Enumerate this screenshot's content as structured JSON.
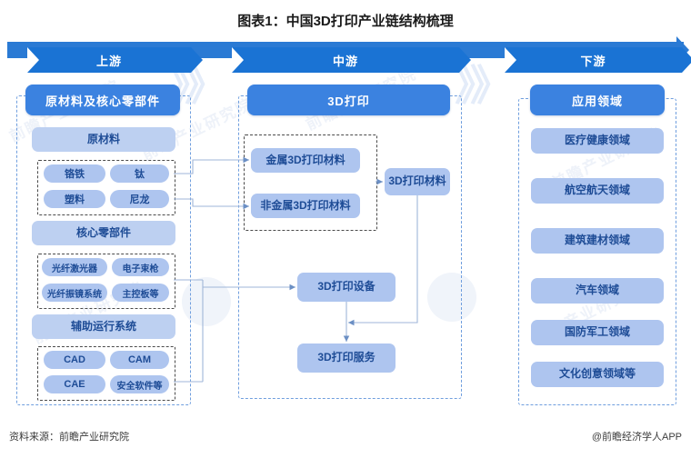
{
  "title": "图表1：中国3D打印产业链结构梳理",
  "banner": {
    "stages": [
      {
        "label": "上游"
      },
      {
        "label": "中游"
      },
      {
        "label": "下游"
      }
    ]
  },
  "upstream": {
    "header": "原材料及核心零部件",
    "groups": [
      {
        "label": "原材料",
        "items": [
          "铬铁",
          "钛",
          "塑料",
          "尼龙"
        ]
      },
      {
        "label": "核心零部件",
        "items": [
          "光纤激光器",
          "电子束枪",
          "光纤振镜系统",
          "主控板等"
        ]
      },
      {
        "label": "辅助运行系统",
        "items": [
          "CAD",
          "CAM",
          "CAE",
          "安全软件等"
        ]
      }
    ]
  },
  "midstream": {
    "header": "3D打印",
    "materials": [
      "金属3D打印材料",
      "非金属3D打印材料"
    ],
    "material_node": "3D打印材料",
    "equipment_node": "3D打印设备",
    "service_node": "3D打印服务"
  },
  "downstream": {
    "header": "应用领域",
    "items": [
      "医疗健康领域",
      "航空航天领域",
      "建筑建材领域",
      "汽车领域",
      "国防军工领域",
      "文化创意领域等"
    ]
  },
  "footer": {
    "source": "资料来源：前瞻产业研究院",
    "brand": "@前瞻经济学人APP"
  },
  "colors": {
    "chevron": "#1a73d4",
    "banner_bar": "#2a7ad4",
    "header_box": "#3b82e0",
    "sub_box": "#aec5ef",
    "text_dark_blue": "#1e4c96"
  }
}
